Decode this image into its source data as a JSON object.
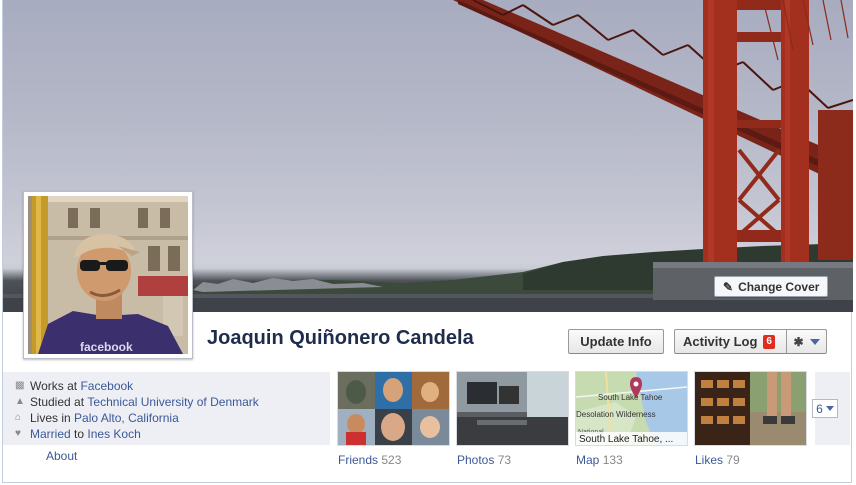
{
  "cover": {
    "change_cover_label": "Change Cover"
  },
  "profile": {
    "name": "Joaquin Quiñonero Candela",
    "shirt_text": "facebook"
  },
  "actions": {
    "update_info_label": "Update Info",
    "activity_log_label": "Activity Log",
    "activity_log_count": "6"
  },
  "info": {
    "work_prefix": "Works at",
    "work_link": "Facebook",
    "study_prefix": "Studied at",
    "study_link": "Technical University of Denmark",
    "lives_prefix": "Lives in",
    "lives_link": "Palo Alto, California",
    "married_link": "Married",
    "married_mid": "to",
    "married_name": "Ines Koch",
    "about_label": "About"
  },
  "tiles": {
    "friends_label": "Friends",
    "friends_count": "523",
    "photos_label": "Photos",
    "photos_count": "73",
    "map_label": "Map",
    "map_count": "133",
    "map_place_top": "South Lake Tahoe",
    "map_place_left": "Desolation Wilderness",
    "map_place_caption": "South Lake Tahoe, ...",
    "map_place_extra": "National",
    "likes_label": "Likes",
    "likes_count": "79",
    "more_count": "6"
  },
  "colors": {
    "link": "#3b5998",
    "badge": "#e02d1f",
    "bridge": "#9a2d1f"
  }
}
